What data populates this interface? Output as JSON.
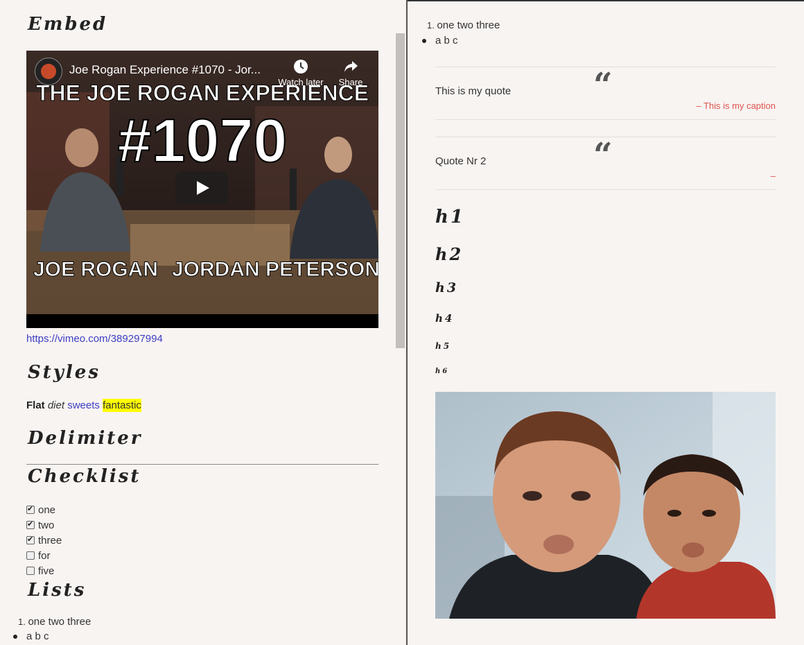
{
  "left": {
    "embed_heading": "Embed",
    "video": {
      "title": "Joe Rogan Experience #1070 - Jor...",
      "watch_later": "Watch later",
      "share": "Share",
      "thumb_line1": "THE JOE ROGAN EXPERIENCE",
      "thumb_line2": "#1070",
      "thumb_left_name": "JOE ROGAN",
      "thumb_right_name": "JORDAN PETERSON"
    },
    "embed_link": "https://vimeo.com/389297994",
    "styles_heading": "Styles",
    "styles": {
      "bold": "Flat",
      "italic": "diet",
      "link": "sweets",
      "marked": "fantastic"
    },
    "delimiter_heading": "Delimiter",
    "checklist_heading": "Checklist",
    "checklist": [
      {
        "label": "one",
        "checked": true
      },
      {
        "label": "two",
        "checked": true
      },
      {
        "label": "three",
        "checked": true
      },
      {
        "label": "for",
        "checked": false
      },
      {
        "label": "five",
        "checked": false
      }
    ],
    "lists_heading": "Lists",
    "ordered_item": "one two three",
    "unordered_item": "a b c"
  },
  "right": {
    "ordered_item": "one two three",
    "unordered_item": "a b c",
    "quotes": [
      {
        "mark": "“",
        "text": "This is my quote",
        "caption": "–    This is my caption"
      },
      {
        "mark": "“",
        "text": "Quote Nr 2",
        "caption": "–"
      }
    ],
    "headings": {
      "h1": "h1",
      "h2": "h2",
      "h3": "h3",
      "h4": "h4",
      "h5": "h5",
      "h6": "h6"
    }
  },
  "colors": {
    "background": "#f8f4f2",
    "link": "#3d3dc4",
    "caption": "#e0534e",
    "highlight": "#ffff00"
  },
  "icons": {
    "watch_later": "clock-icon",
    "share": "share-arrow-icon",
    "play": "play-icon"
  }
}
